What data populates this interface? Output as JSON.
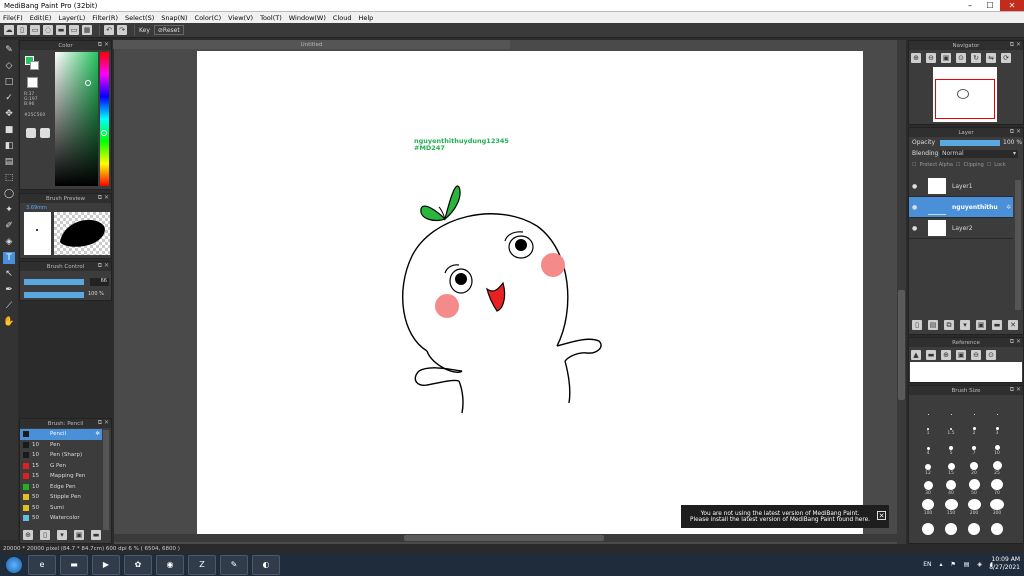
{
  "window": {
    "title": "MediBang Paint Pro (32bit)"
  },
  "menu": [
    "File(F)",
    "Edit(E)",
    "Layer(L)",
    "Filter(R)",
    "Select(S)",
    "Snap(N)",
    "Color(C)",
    "View(V)",
    "Tool(T)",
    "Window(W)",
    "Cloud",
    "Help"
  ],
  "toolbar": {
    "key_label": "Key",
    "reset_label": "Reset"
  },
  "canvas": {
    "tab_title": "Untitled",
    "watermark_line1": "nguyenthithuydung12345",
    "watermark_line2": "#MD247"
  },
  "color_panel": {
    "title": "Color",
    "values": "R:37\nG:197\nB:96",
    "hex": "#25C560",
    "fg_color": "#25c560",
    "bg_color": "#ffffff"
  },
  "brush_preview": {
    "title": "Brush Preview",
    "size": "3.69mm"
  },
  "brush_control": {
    "title": "Brush Control",
    "size_value": "66",
    "opacity_value": "100 %"
  },
  "brush_list": {
    "title": "Brush: Pencil",
    "items": [
      {
        "size": "",
        "name": "Pencil",
        "color": "#1a1a1a"
      },
      {
        "size": "10",
        "name": "Pen",
        "color": "#1a1a1a"
      },
      {
        "size": "10",
        "name": "Pen (Sharp)",
        "color": "#1a1a1a"
      },
      {
        "size": "15",
        "name": "G Pen",
        "color": "#e02020"
      },
      {
        "size": "15",
        "name": "Mapping Pen",
        "color": "#e02020"
      },
      {
        "size": "10",
        "name": "Edge Pen",
        "color": "#20b020"
      },
      {
        "size": "50",
        "name": "Stipple Pen",
        "color": "#e0c020"
      },
      {
        "size": "50",
        "name": "Sumi",
        "color": "#e0c020"
      },
      {
        "size": "50",
        "name": "Watercolor",
        "color": "#60c0e0"
      }
    ]
  },
  "navigator": {
    "title": "Navigator"
  },
  "layer_panel": {
    "title": "Layer",
    "opacity_label": "Opacity",
    "opacity_value": "100 %",
    "blending_label": "Blending",
    "blending_value": "Normal",
    "protect_alpha": "Protect Alpha",
    "clipping": "Clipping",
    "lock": "Lock",
    "layers": [
      {
        "name": "Layer1",
        "active": false
      },
      {
        "name": "nguyenthithu",
        "active": true
      },
      {
        "name": "Layer2",
        "active": false
      }
    ]
  },
  "reference": {
    "title": "Reference"
  },
  "brush_size": {
    "title": "Brush Size",
    "labels": [
      "",
      "",
      "",
      "",
      "1",
      "1.5",
      "2",
      "3",
      "4",
      "5",
      "7",
      "10",
      "12",
      "15",
      "20",
      "25",
      "30",
      "40",
      "50",
      "70",
      "100",
      "150",
      "200",
      "300",
      "",
      "",
      "",
      ""
    ]
  },
  "notification": {
    "line1": "You are not using the latest version of MediBang Paint.",
    "line2": "Please install the latest version of MediBang Paint found here."
  },
  "status": {
    "text": "20000 * 20000 pixel  (84.7 * 84.7cm)  600 dpi  6 %  ( 6504, 6800 )"
  },
  "taskbar": {
    "time": "10:09 AM",
    "date": "8/27/2021",
    "lang": "EN"
  }
}
